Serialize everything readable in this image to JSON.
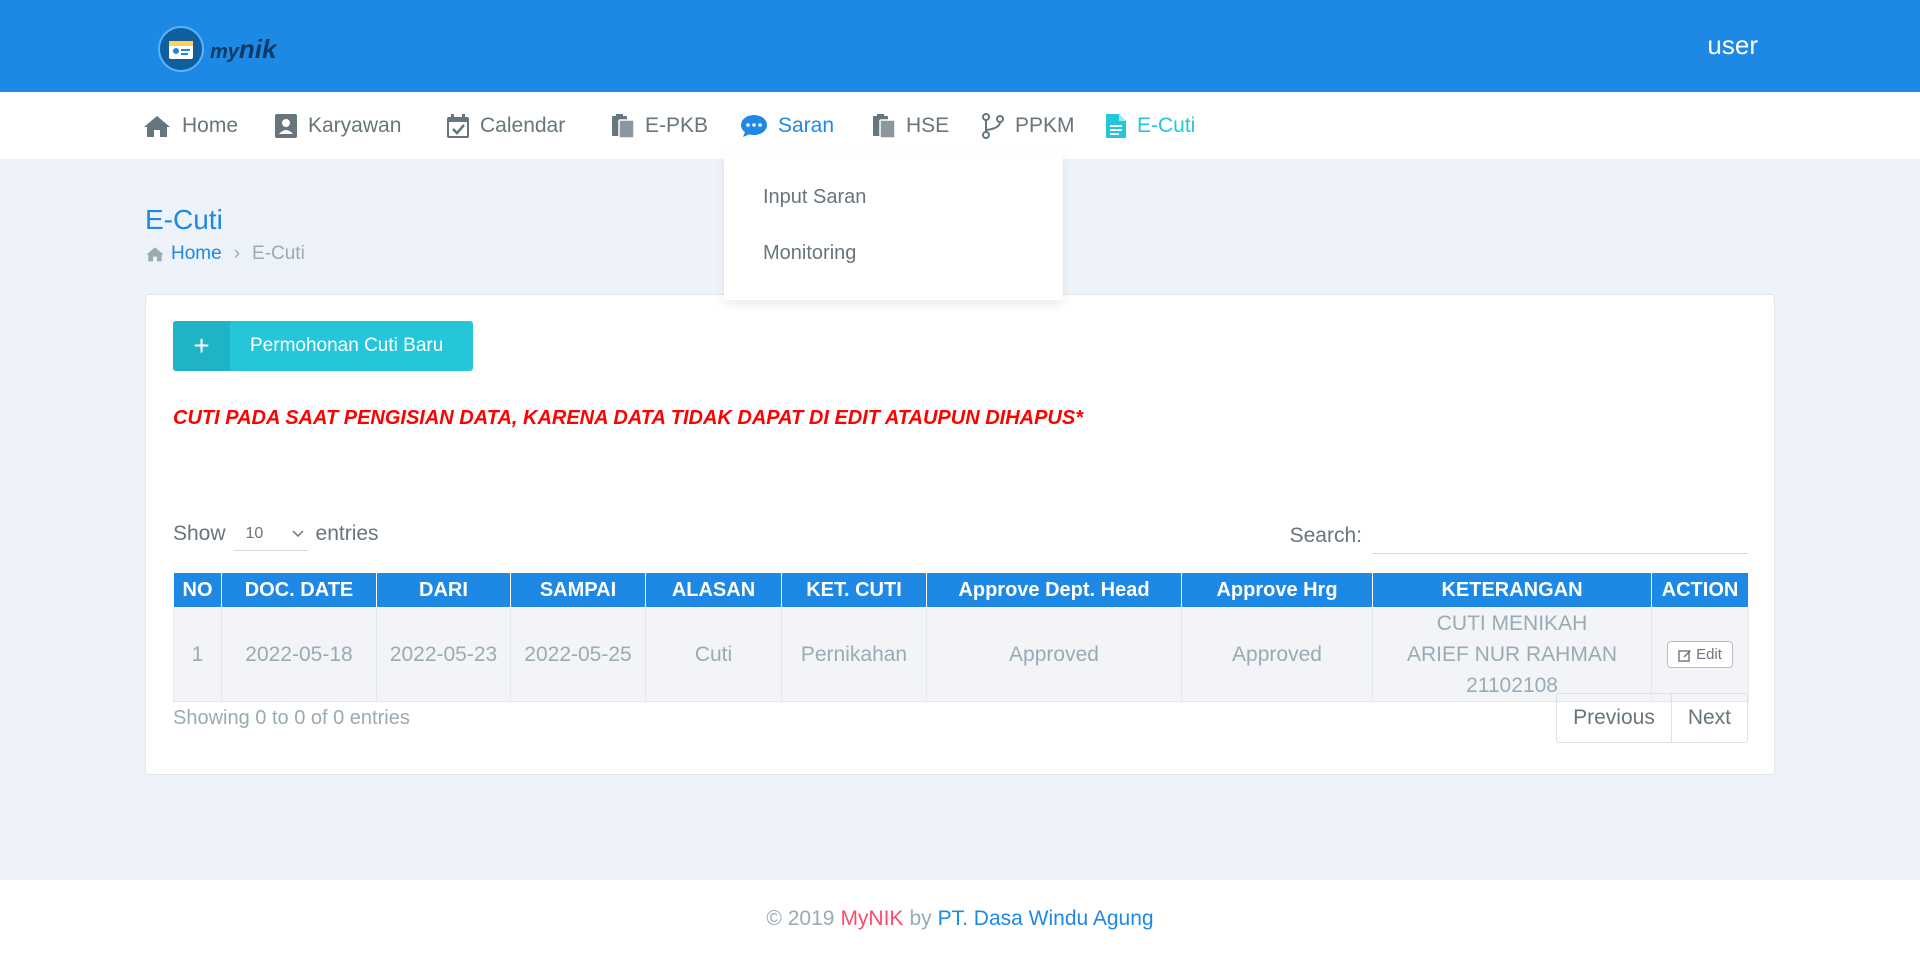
{
  "header": {
    "logo_prefix": "my",
    "logo_name": "nik",
    "user_label": "user"
  },
  "nav": {
    "home": "Home",
    "karyawan": "Karyawan",
    "calendar": "Calendar",
    "epkb": "E-PKB",
    "saran": "Saran",
    "hse": "HSE",
    "ppkm": "PPKM",
    "ecuti": "E-Cuti"
  },
  "saran_menu": {
    "input": "Input Saran",
    "monitoring": "Monitoring"
  },
  "page": {
    "title": "E-Cuti",
    "breadcrumb_home": "Home",
    "breadcrumb_current": "E-Cuti"
  },
  "card": {
    "new_button": "Permohonan Cuti Baru",
    "warning": "CUTI PADA SAAT PENGISIAN DATA, KARENA DATA TIDAK DAPAT DI EDIT ATAUPUN DIHAPUS*"
  },
  "table_controls": {
    "show": "Show",
    "entries_value": "10",
    "entries": "entries",
    "search": "Search:"
  },
  "table": {
    "headers": [
      "NO",
      "DOC. DATE",
      "DARI",
      "SAMPAI",
      "ALASAN",
      "KET. CUTI",
      "Approve Dept. Head",
      "Approve Hrg",
      "KETERANGAN",
      "ACTION"
    ],
    "rows": [
      {
        "no": "1",
        "doc_date": "2022-05-18",
        "dari": "2022-05-23",
        "sampai": "2022-05-25",
        "alasan": "Cuti",
        "ket_cuti": "Pernikahan",
        "approve_dept": "Approved",
        "approve_hrg": "Approved",
        "keterangan_1": "CUTI MENIKAH",
        "keterangan_2": "ARIEF NUR RAHMAN 21102108",
        "action": "Edit"
      }
    ]
  },
  "table_footer": {
    "info": "Showing 0 to 0 of 0 entries",
    "previous": "Previous",
    "next": "Next"
  },
  "footer": {
    "copyright": "© 2019",
    "brand": "MyNIK",
    "by": "by",
    "company": "PT. Dasa Windu Agung"
  },
  "colors": {
    "primary": "#1e88e5",
    "info": "#26c6da",
    "danger": "#ff0000",
    "brand_pink": "#fc4b6c"
  }
}
